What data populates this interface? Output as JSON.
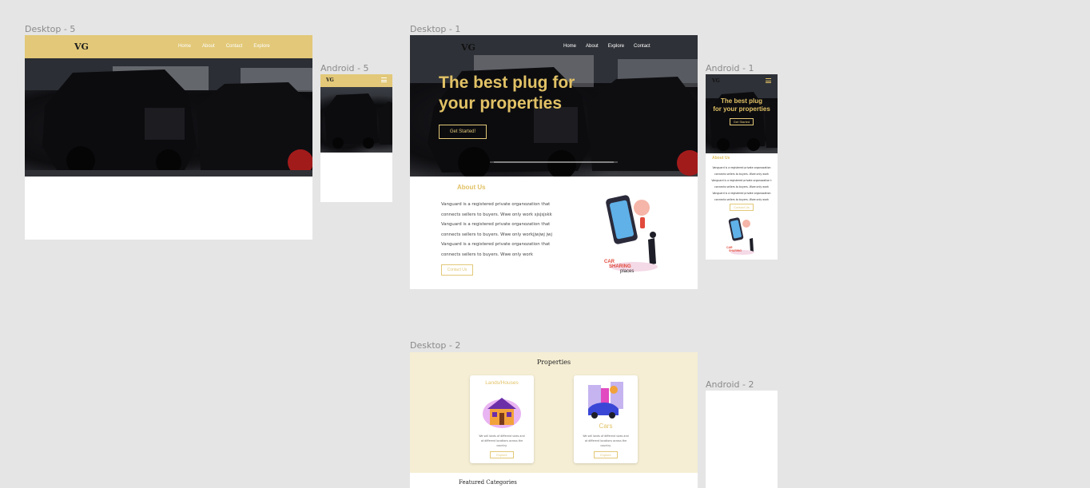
{
  "canvas_bg": "#e5e5e5",
  "accent": "#e2c878",
  "frames": {
    "desktop5": {
      "label": "Desktop - 5",
      "logo": "VG",
      "nav": [
        "Home",
        "About",
        "Contact",
        "Explore"
      ]
    },
    "android5": {
      "label": "Android - 5",
      "logo": "VG",
      "menu_icon": "hamburger-icon"
    },
    "desktop1": {
      "label": "Desktop - 1",
      "logo": "VG",
      "nav": [
        "Home",
        "About",
        "Explore",
        "Contact"
      ],
      "hero_title_line1": "The best plug for",
      "hero_title_line2": "your properties",
      "cta": "Get Started!",
      "about_heading": "About Us",
      "about_lines": [
        "Vanguard is a registered private organozation that",
        "connects sellers to buyers. Wwe only work  sjsjsjskk",
        "Vanguard is a registered private organozation that",
        "connects sellers to buyers. Wwe only workjjwjwj jwj",
        "Vanguard is a registered private organozation that",
        "connects sellers to buyers. Wwe only work"
      ],
      "contact_btn": "Contact Us",
      "illustration_text_1": "CAR",
      "illustration_text_2": "SHARING",
      "illustration_text_3": "places"
    },
    "android1": {
      "label": "Android - 1",
      "logo": "VG",
      "hero_line1": "The best plug",
      "hero_line2": "for your properties",
      "cta": "Get Started",
      "about_heading": "About Us",
      "about_lines": [
        "Vanguard is a registered private organozation",
        "connects sellers to buyers. Wwe only work",
        "Vanguard is a registered private organozation t",
        "connects sellers to buyers. Wwe only work",
        "Vanguard is a registered private organozation",
        "connects sellers to buyers. Wwe only work"
      ],
      "contact_btn": "Contact Us",
      "illustration_text_1": "CAR",
      "illustration_text_2": "SHARING"
    },
    "desktop2": {
      "label": "Desktop - 2",
      "heading": "Properties",
      "cards": [
        {
          "title": "Lands/Houses",
          "text_lines": [
            "We sell lands of different sizes and",
            "at different locations across the",
            "country."
          ],
          "button": "Explore"
        },
        {
          "title": "Cars",
          "text_lines": [
            "We sell lands of different sizes and",
            "at different locations across the",
            "country."
          ],
          "button": "Explore"
        }
      ],
      "featured": "Featured Categories"
    },
    "android2": {
      "label": "Android - 2"
    }
  }
}
